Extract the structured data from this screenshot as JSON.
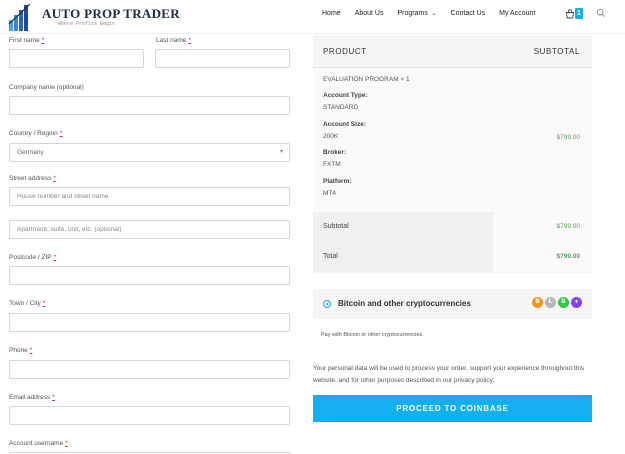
{
  "brand": {
    "title": "AUTO PROP TRADER",
    "tagline": "Where Profits Begin"
  },
  "nav": {
    "home": "Home",
    "about": "About Us",
    "programs": "Programs",
    "contact": "Contact Us",
    "account": "My Account",
    "cart_count": "1"
  },
  "form": {
    "first_name_label": "First name",
    "last_name_label": "Last name",
    "company_label": "Company name (optional)",
    "country_label": "Country / Region",
    "country_value": "Germany",
    "street_label": "Street address",
    "street_placeholder": "House number and street name",
    "street2_placeholder": "Apartment, suite, unit, etc. (optional)",
    "postcode_label": "Postcode / ZIP",
    "city_label": "Town / City",
    "phone_label": "Phone",
    "email_label": "Email address",
    "username_label": "Account username",
    "required_mark": "*"
  },
  "order": {
    "col_product": "PRODUCT",
    "col_subtotal": "SUBTOTAL",
    "item_name": "EVALUATION PROGRAM",
    "item_qty": "× 1",
    "account_type_label": "Account Type:",
    "account_type_value": "STANDARD",
    "account_size_label": "Account Size:",
    "account_size_value": "200K",
    "broker_label": "Broker:",
    "broker_value": "FXTM",
    "platform_label": "Platform:",
    "platform_value": "MT4",
    "item_price": "$799.00",
    "subtotal_label": "Subtotal",
    "subtotal_value": "$799.00",
    "total_label": "Total",
    "total_value": "$799.00"
  },
  "payment": {
    "method_title": "Bitcoin and other cryptocurrencies",
    "method_desc": "Pay with Bitcoin or other cryptocurrencies.",
    "privacy_text": "Your personal data will be used to process your order, support your experience throughout this website, and for other purposes described in our privacy policy.",
    "button_label": "PROCEED TO COINBASE",
    "coins": [
      {
        "icon": "bitcoin-icon",
        "glyph": "B",
        "color": "#f7931a"
      },
      {
        "icon": "litecoin-icon",
        "glyph": "Ł",
        "color": "#b8b8b8"
      },
      {
        "icon": "bitcoin-cash-icon",
        "glyph": "B",
        "color": "#2ecc40"
      },
      {
        "icon": "ethereum-icon",
        "glyph": "♦",
        "color": "#8a3ffc"
      }
    ]
  },
  "colors": {
    "accent": "#13aff0",
    "price": "#5aa05a",
    "required": "#e01a1a"
  }
}
